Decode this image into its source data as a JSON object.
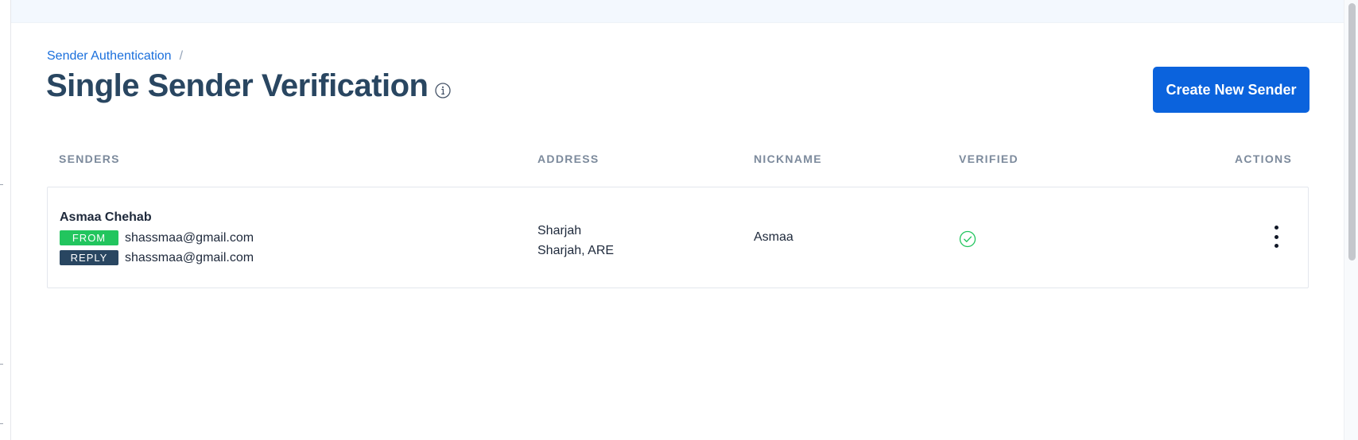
{
  "breadcrumb": {
    "parent": "Sender Authentication",
    "separator": "/"
  },
  "page": {
    "title": "Single Sender Verification"
  },
  "header": {
    "create_button_label": "Create New Sender"
  },
  "table": {
    "columns": [
      "SENDERS",
      "ADDRESS",
      "NICKNAME",
      "VERIFIED",
      "ACTIONS"
    ],
    "rows": [
      {
        "name": "Asmaa Chehab",
        "from_badge": "FROM",
        "from_email": "shassmaa@gmail.com",
        "reply_badge": "REPLY",
        "reply_email": "shassmaa@gmail.com",
        "address_line1": "Sharjah",
        "address_line2": "Sharjah, ARE",
        "nickname": "Asmaa",
        "verified": true
      }
    ]
  },
  "colors": {
    "link": "#1a6fdc",
    "title": "#294661",
    "primary_button": "#0b63dd",
    "from_badge": "#22c55e",
    "reply_badge": "#294661",
    "verified": "#22c55e"
  },
  "icons": {
    "title_info": "info-circle-icon",
    "verified": "check-circle-icon",
    "actions": "more-vertical-icon"
  }
}
